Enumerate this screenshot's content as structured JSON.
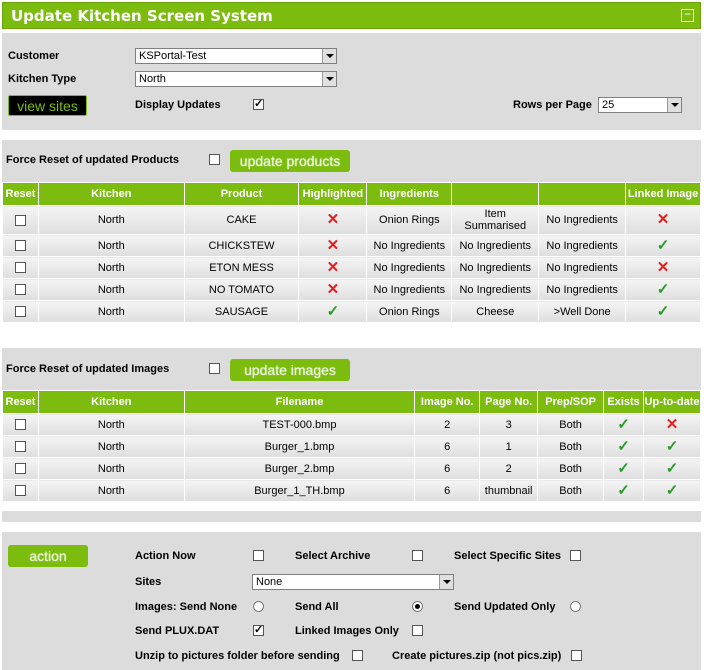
{
  "title": "Update Kitchen Screen System",
  "top": {
    "customer_label": "Customer",
    "customer_value": "KSPortal-Test",
    "kitchen_type_label": "Kitchen Type",
    "kitchen_type_value": "North",
    "view_sites": "view sites",
    "display_updates_label": "Display Updates",
    "display_updates_checked": true,
    "rows_per_page_label": "Rows per Page",
    "rows_per_page_value": "25"
  },
  "products": {
    "force_reset_label": "Force Reset of updated Products",
    "update_button": "update products",
    "headers": [
      "Reset",
      "Kitchen",
      "Product",
      "Highlighted",
      "Ingredients",
      "",
      "",
      "Linked Image"
    ],
    "rows": [
      {
        "kitchen": "North",
        "product": "CAKE",
        "highlighted": false,
        "ing1": "Onion Rings",
        "ing2": "Item Summarised",
        "ing3": "No Ingredients",
        "linked": false
      },
      {
        "kitchen": "North",
        "product": "CHICKSTEW",
        "highlighted": false,
        "ing1": "No Ingredients",
        "ing2": "No Ingredients",
        "ing3": "No Ingredients",
        "linked": true
      },
      {
        "kitchen": "North",
        "product": "ETON MESS",
        "highlighted": false,
        "ing1": "No Ingredients",
        "ing2": "No Ingredients",
        "ing3": "No Ingredients",
        "linked": false
      },
      {
        "kitchen": "North",
        "product": "NO TOMATO",
        "highlighted": false,
        "ing1": "No Ingredients",
        "ing2": "No Ingredients",
        "ing3": "No Ingredients",
        "linked": true
      },
      {
        "kitchen": "North",
        "product": "SAUSAGE",
        "highlighted": true,
        "ing1": "Onion Rings",
        "ing2": "Cheese",
        "ing3": ">Well Done",
        "linked": true
      }
    ]
  },
  "images": {
    "force_reset_label": "Force Reset of updated Images",
    "update_button": "update images",
    "headers": [
      "Reset",
      "Kitchen",
      "Filename",
      "Image No.",
      "Page No.",
      "Prep/SOP",
      "Exists",
      "Up-to-date"
    ],
    "rows": [
      {
        "kitchen": "North",
        "filename": "TEST-000.bmp",
        "image_no": "2",
        "page_no": "3",
        "prep": "Both",
        "exists": true,
        "uptodate": false
      },
      {
        "kitchen": "North",
        "filename": "Burger_1.bmp",
        "image_no": "6",
        "page_no": "1",
        "prep": "Both",
        "exists": true,
        "uptodate": true
      },
      {
        "kitchen": "North",
        "filename": "Burger_2.bmp",
        "image_no": "6",
        "page_no": "2",
        "prep": "Both",
        "exists": true,
        "uptodate": true
      },
      {
        "kitchen": "North",
        "filename": "Burger_1_TH.bmp",
        "image_no": "6",
        "page_no": "thumbnail",
        "prep": "Both",
        "exists": true,
        "uptodate": true
      }
    ]
  },
  "action": {
    "button": "action",
    "action_now_label": "Action Now",
    "select_archive_label": "Select Archive",
    "select_sites_label": "Select Specific Sites",
    "sites_label": "Sites",
    "sites_value": "None",
    "images_send_none_label": "Images: Send None",
    "send_all_label": "Send All",
    "send_updated_only_label": "Send Updated Only",
    "send_plux_label": "Send PLUX.DAT",
    "send_plux_checked": true,
    "linked_images_only_label": "Linked Images Only",
    "unzip_label": "Unzip to pictures folder before sending",
    "create_zip_label": "Create pictures.zip (not pics.zip)"
  },
  "colors": {
    "accent": "#7cbc0f",
    "panel": "#dcdcdc",
    "cross": "#e02020",
    "tick": "#2a9a2a"
  }
}
